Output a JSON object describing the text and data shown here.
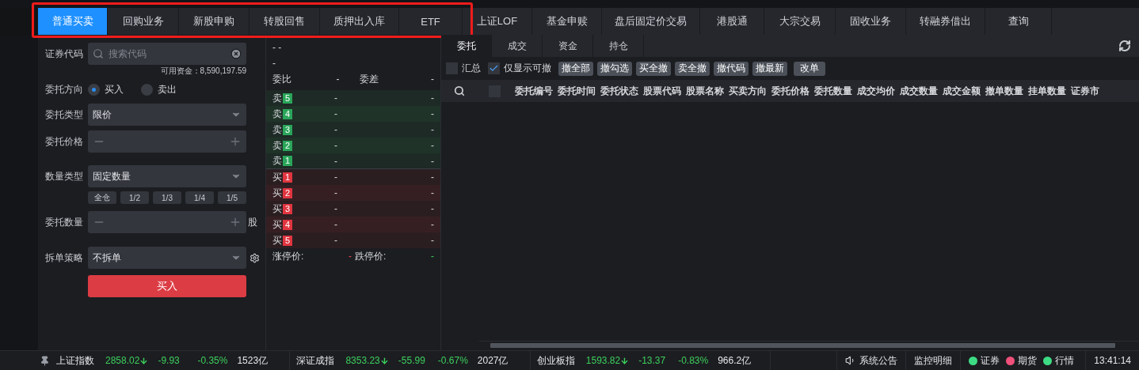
{
  "tabs": [
    {
      "label": "普通买卖",
      "selected": true
    },
    {
      "label": "回购业务",
      "selected": false
    },
    {
      "label": "新股申购",
      "selected": false
    },
    {
      "label": "转股回售",
      "selected": false
    },
    {
      "label": "质押出入库",
      "selected": false
    },
    {
      "label": "ETF",
      "selected": false
    },
    {
      "label": "上证LOF",
      "selected": false
    },
    {
      "label": "基金申赎",
      "selected": false
    },
    {
      "label": "盘后固定价交易",
      "selected": false
    },
    {
      "label": "港股通",
      "selected": false
    },
    {
      "label": "大宗交易",
      "selected": false
    },
    {
      "label": "固收业务",
      "selected": false
    },
    {
      "label": "转融券借出",
      "selected": false
    },
    {
      "label": "查询",
      "selected": false
    }
  ],
  "order_form": {
    "code": {
      "label": "证券代码",
      "placeholder": "搜索代码"
    },
    "available_funds": "可用资金：8,590,197.59",
    "direction": {
      "label": "委托方向",
      "options": [
        {
          "label": "买入",
          "selected": true
        },
        {
          "label": "卖出",
          "selected": false
        }
      ]
    },
    "order_type": {
      "label": "委托类型",
      "value": "限价"
    },
    "price": {
      "label": "委托价格"
    },
    "quantity_type": {
      "label": "数量类型",
      "value": "固定数量"
    },
    "quick_amounts": [
      "全仓",
      "1/2",
      "1/3",
      "1/4",
      "1/5"
    ],
    "quantity": {
      "label": "委托数量",
      "unit": "股"
    },
    "split_strategy": {
      "label": "拆单策略",
      "value": "不拆单"
    },
    "submit": "买入"
  },
  "order_book": {
    "top_lines": [
      "- -",
      "-"
    ],
    "ratio": {
      "label": "委比",
      "value": "-",
      "diff_label": "委差",
      "diff_value": "-"
    },
    "asks": [
      {
        "side": "卖",
        "level": "5",
        "price": "-",
        "volume": "-"
      },
      {
        "side": "卖",
        "level": "4",
        "price": "-",
        "volume": "-"
      },
      {
        "side": "卖",
        "level": "3",
        "price": "-",
        "volume": "-"
      },
      {
        "side": "卖",
        "level": "2",
        "price": "-",
        "volume": "-"
      },
      {
        "side": "卖",
        "level": "1",
        "price": "-",
        "volume": "-"
      }
    ],
    "bids": [
      {
        "side": "买",
        "level": "1",
        "price": "-",
        "volume": "-"
      },
      {
        "side": "买",
        "level": "2",
        "price": "-",
        "volume": "-"
      },
      {
        "side": "买",
        "level": "3",
        "price": "-",
        "volume": "-"
      },
      {
        "side": "买",
        "level": "4",
        "price": "-",
        "volume": "-"
      },
      {
        "side": "买",
        "level": "5",
        "price": "-",
        "volume": "-"
      }
    ],
    "limits": {
      "up_label": "涨停价:",
      "up_value": "-",
      "down_label": "跌停价:",
      "down_value": "-"
    }
  },
  "orders_panel": {
    "tabs": [
      {
        "label": "委托",
        "selected": true
      },
      {
        "label": "成交",
        "selected": false
      },
      {
        "label": "资金",
        "selected": false
      },
      {
        "label": "持仓",
        "selected": false
      }
    ],
    "filters": [
      {
        "label": "汇总",
        "checked": false
      },
      {
        "label": "仅显示可撤",
        "checked": true
      }
    ],
    "select_all_checked": false,
    "actions": [
      "撤全部",
      "撤勾选",
      "买全撤",
      "卖全撤",
      "撤代码",
      "撤最新",
      "改单"
    ],
    "columns": [
      "委托编号",
      "委托时间",
      "委托状态",
      "股票代码",
      "股票名称",
      "买卖方向",
      "委托价格",
      "委托数量",
      "成交均价",
      "成交数量",
      "成交金额",
      "撤单数量",
      "挂单数量",
      "证券市"
    ]
  },
  "status_bar": {
    "indices": [
      {
        "name": "上证指数",
        "value": "2858.02",
        "change": "-9.93",
        "percent": "-0.35%",
        "turnover": "1523亿"
      },
      {
        "name": "深证成指",
        "value": "8353.23",
        "change": "-55.99",
        "percent": "-0.67%",
        "turnover": "2027亿"
      },
      {
        "name": "创业板指",
        "value": "1593.82",
        "change": "-13.37",
        "percent": "-0.83%",
        "turnover": "966.2亿"
      }
    ],
    "announcement": "系统公告",
    "monitor": "监控明细",
    "connections": [
      {
        "label": "证券",
        "color": "#3ddc84"
      },
      {
        "label": "期货",
        "color": "#f0507a"
      },
      {
        "label": "行情",
        "color": "#3ddc84"
      }
    ],
    "time": "13:41:14"
  }
}
